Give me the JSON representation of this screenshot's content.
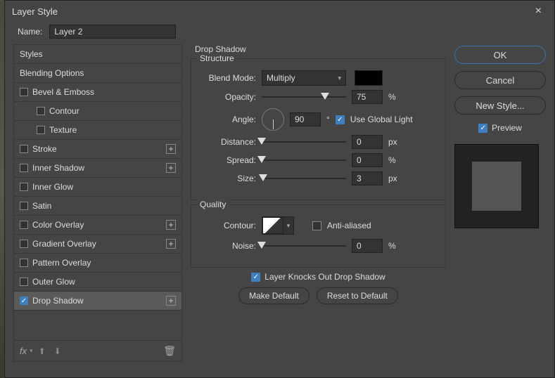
{
  "title": "Layer Style",
  "name_label": "Name:",
  "name_value": "Layer 2",
  "styles_header": "Styles",
  "styles": [
    {
      "label": "Blending Options",
      "chk": null,
      "plus": false,
      "indent": false
    },
    {
      "label": "Bevel & Emboss",
      "chk": false,
      "plus": false,
      "indent": false
    },
    {
      "label": "Contour",
      "chk": false,
      "plus": false,
      "indent": true
    },
    {
      "label": "Texture",
      "chk": false,
      "plus": false,
      "indent": true
    },
    {
      "label": "Stroke",
      "chk": false,
      "plus": true,
      "indent": false
    },
    {
      "label": "Inner Shadow",
      "chk": false,
      "plus": true,
      "indent": false
    },
    {
      "label": "Inner Glow",
      "chk": false,
      "plus": false,
      "indent": false
    },
    {
      "label": "Satin",
      "chk": false,
      "plus": false,
      "indent": false
    },
    {
      "label": "Color Overlay",
      "chk": false,
      "plus": true,
      "indent": false
    },
    {
      "label": "Gradient Overlay",
      "chk": false,
      "plus": true,
      "indent": false
    },
    {
      "label": "Pattern Overlay",
      "chk": false,
      "plus": false,
      "indent": false
    },
    {
      "label": "Outer Glow",
      "chk": false,
      "plus": false,
      "indent": false
    },
    {
      "label": "Drop Shadow",
      "chk": true,
      "plus": true,
      "indent": false,
      "selected": true
    }
  ],
  "fx_label": "fx",
  "section_title": "Drop Shadow",
  "structure": {
    "legend": "Structure",
    "blend_mode_label": "Blend Mode:",
    "blend_mode_value": "Multiply",
    "opacity_label": "Opacity:",
    "opacity_value": "75",
    "opacity_unit": "%",
    "angle_label": "Angle:",
    "angle_value": "90",
    "angle_unit": "°",
    "global_light_label": "Use Global Light",
    "distance_label": "Distance:",
    "distance_value": "0",
    "distance_unit": "px",
    "spread_label": "Spread:",
    "spread_value": "0",
    "spread_unit": "%",
    "size_label": "Size:",
    "size_value": "3",
    "size_unit": "px"
  },
  "quality": {
    "legend": "Quality",
    "contour_label": "Contour:",
    "antialiased_label": "Anti-aliased",
    "noise_label": "Noise:",
    "noise_value": "0",
    "noise_unit": "%"
  },
  "knockout_label": "Layer Knocks Out Drop Shadow",
  "make_default": "Make Default",
  "reset_default": "Reset to Default",
  "buttons": {
    "ok": "OK",
    "cancel": "Cancel",
    "new_style": "New Style...",
    "preview": "Preview"
  }
}
